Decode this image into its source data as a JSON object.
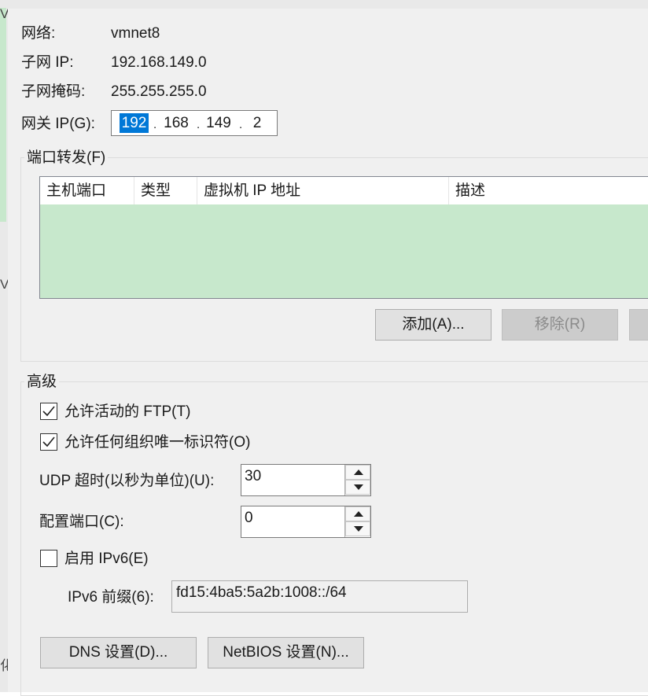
{
  "network": {
    "network_label": "网络:",
    "network_value": "vmnet8",
    "subnet_ip_label": "子网 IP:",
    "subnet_ip_value": "192.168.149.0",
    "subnet_mask_label": "子网掩码:",
    "subnet_mask_value": "255.255.255.0",
    "gateway_label": "网关 IP(G):",
    "gateway_octets": [
      "192",
      "168",
      "149",
      "2"
    ]
  },
  "port_forwarding": {
    "title": "端口转发(F)",
    "columns": [
      "主机端口",
      "类型",
      "虚拟机 IP 地址",
      "描述"
    ],
    "rows": [],
    "add_button": "添加(A)...",
    "remove_button": "移除(R)"
  },
  "advanced": {
    "title": "高级",
    "allow_active_ftp": {
      "label": "允许活动的 FTP(T)",
      "checked": true
    },
    "allow_any_oui": {
      "label": "允许任何组织唯一标识符(O)",
      "checked": true
    },
    "udp_timeout": {
      "label": "UDP 超时(以秒为单位)(U):",
      "value": "30"
    },
    "config_port": {
      "label": "配置端口(C):",
      "value": "0"
    },
    "enable_ipv6": {
      "label": "启用 IPv6(E)",
      "checked": false
    },
    "ipv6_prefix": {
      "label": "IPv6 前缀(6):",
      "value": "fd15:4ba5:5a2b:1008::/64"
    }
  },
  "buttons": {
    "dns": "DNS 设置(D)...",
    "netbios": "NetBIOS 设置(N)..."
  },
  "background_fragments": [
    "V",
    "V",
    "化"
  ],
  "colors": {
    "selection": "#0078d7",
    "table_body": "#c7e8cc"
  }
}
